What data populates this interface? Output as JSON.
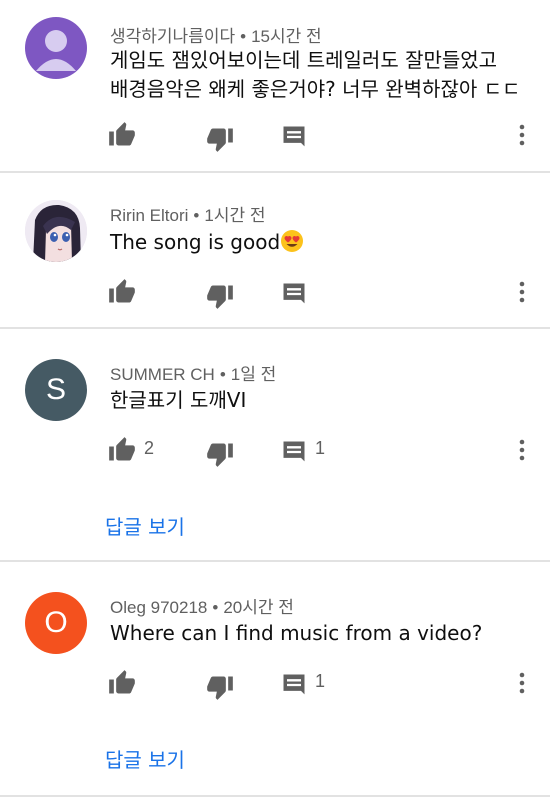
{
  "comments": [
    {
      "author": "생각하기나름이다",
      "time": "15시간 전",
      "text_line1": "게임도 잼있어보이는데 트레일러도 잘만들었고",
      "text_line2": "배경음악은 왜케 좋은거야? 너무 완벽하잖아 ㄷㄷ",
      "avatar": "default-user-avatar",
      "avatar_color": "#7e57c2",
      "likes": "",
      "replies_count": ""
    },
    {
      "author": "Ririn Eltori",
      "time": "1시간 전",
      "text": "The song is good",
      "emoji": "heart-eyes-emoji",
      "avatar": "anime-girl-avatar",
      "likes": "",
      "replies_count": ""
    },
    {
      "author": "SUMMER CH",
      "time": "1일 전",
      "text": "한글표기 도깨VI",
      "avatar_letter": "S",
      "avatar_color": "#455a64",
      "likes": "2",
      "replies_count": "1",
      "view_replies": "답글 보기"
    },
    {
      "author": "Oleg 970218",
      "time": "20시간 전",
      "text": "Where can I find music from a video?",
      "avatar_letter": "O",
      "avatar_color": "#f4511e",
      "likes": "",
      "replies_count": "1",
      "view_replies": "답글 보기"
    }
  ],
  "separator": "•",
  "colors": {
    "meta_text": "#606060",
    "link_blue": "#1a73e8",
    "icon_gray": "#606060",
    "divider": "#e2e2e2"
  }
}
